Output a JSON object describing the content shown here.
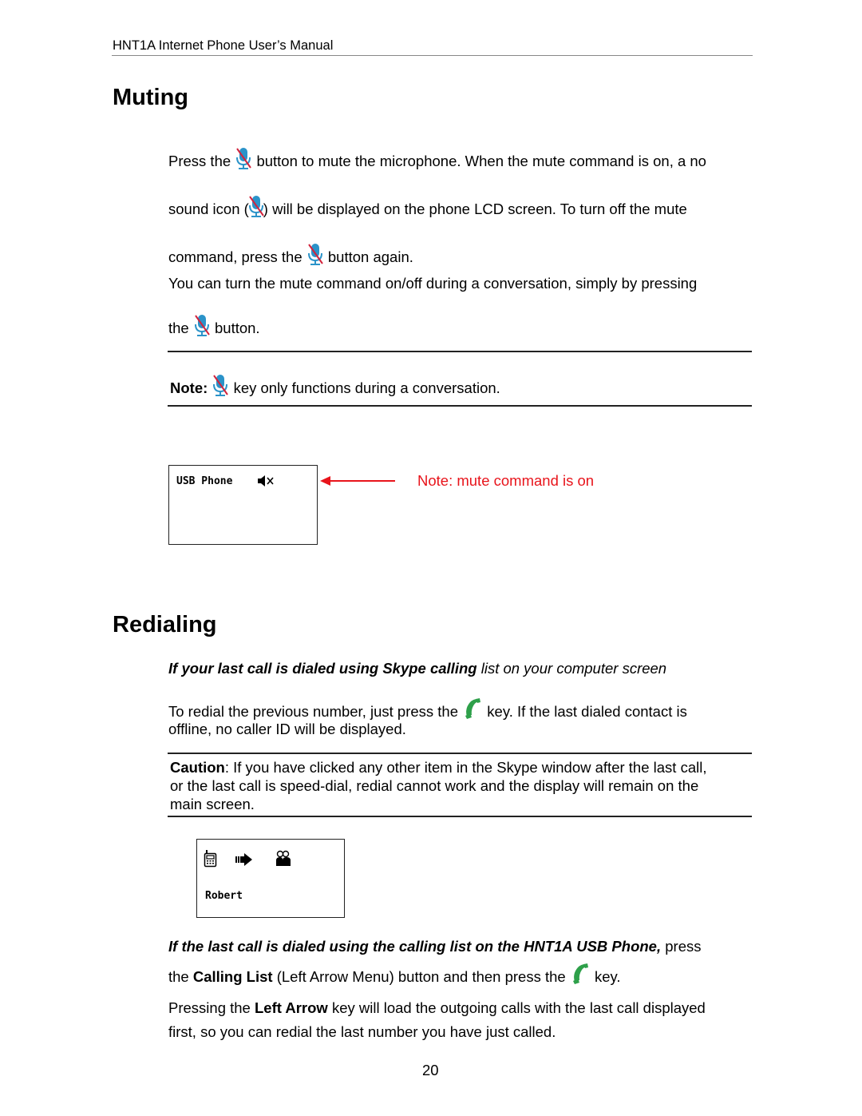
{
  "header": {
    "title": "HNT1A Internet Phone User’s Manual"
  },
  "muting": {
    "heading": "Muting",
    "p1_a": "Press the",
    "p1_b": "button to mute the microphone. When the mute command is on, a no",
    "p2_a": "sound icon (",
    "p2_b": ") will be displayed on the phone LCD screen. To turn off the mute",
    "p3_a": "command, press the",
    "p3_b": "button again.",
    "p4": "You can turn the mute command on/off during a conversation, simply by pressing",
    "p5_a": "the",
    "p5_b": "button.",
    "note_label": "Note:",
    "note_text": "key only functions during a conversation.",
    "lcd": {
      "line1": "USB Phone",
      "status_icon": "speaker-muted-icon"
    },
    "callout": "Note: mute command is on",
    "icon": "mic-muted-icon",
    "colors": {
      "mic": "#2b93c9",
      "slash": "#d2233c",
      "callout": "#e8141b"
    }
  },
  "redialing": {
    "heading": "Redialing",
    "sub1_bold": "If your last call is dialed using Skype calling",
    "sub1_rest": " list on your computer screen",
    "p1_a": "To redial the previous number, just press the",
    "p1_b": "key. If the last dialed contact is",
    "p1_c": "offline, no caller ID will be displayed.",
    "caution_label": "Caution",
    "caution_l1": ": If you have clicked any other item in the Skype window after the last call,",
    "caution_l2": "or the last call is speed-dial, redial cannot work and the display will remain on the",
    "caution_l3": "main screen.",
    "lcd": {
      "icons": [
        "handset-icon",
        "arrow-right-icon",
        "contacts-icon"
      ],
      "name": "Robert"
    },
    "sub2_bold": "If the last call is dialed using the calling list on the HNT1A USB Phone,",
    "sub2_rest": " press",
    "p2_a": "the ",
    "p2_bold": "Calling List",
    "p2_b": " (Left Arrow Menu) button and then press the",
    "p2_c": "key.",
    "p3_a": "Pressing the ",
    "p3_bold": "Left Arrow",
    "p3_b": " key will load the outgoing calls with the last call displayed",
    "p3_c": "first, so you can redial the last number you have just called.",
    "icon": "phone-call-icon",
    "colors": {
      "phone": "#2ea04a"
    }
  },
  "footer": {
    "page_number": "20"
  }
}
